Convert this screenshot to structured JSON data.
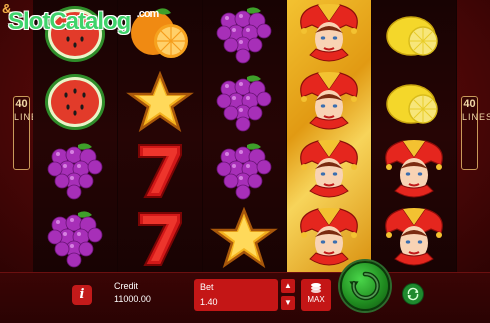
{
  "branding": {
    "top_logo": "&",
    "watermark": "SlotCatalog",
    "watermark_suffix": ".com"
  },
  "lines": {
    "count": "40",
    "word": "LINES"
  },
  "reels": [
    [
      "watermelon",
      "watermelon",
      "grapes",
      "grapes"
    ],
    [
      "orange",
      "star",
      "seven",
      "seven"
    ],
    [
      "grapes",
      "grapes",
      "grapes",
      "star"
    ],
    [
      "jester",
      "jester",
      "jester",
      "jester"
    ],
    [
      "lemon",
      "lemon",
      "jester",
      "jester"
    ]
  ],
  "controls": {
    "info_label": "i",
    "credit_label": "Credit",
    "credit_value": "11000.00",
    "bet_label": "Bet",
    "bet_value": "1.40",
    "max_label": "MAX"
  },
  "icons": {
    "info": "info-icon",
    "up": "arrow-up-icon",
    "down": "arrow-down-icon",
    "coins": "coins-icon",
    "spin": "spin-icon",
    "autoplay": "autoplay-icon"
  },
  "colors": {
    "accent_red": "#c41616",
    "spin_green": "#1f8a1f",
    "gold": "#f3c231"
  }
}
